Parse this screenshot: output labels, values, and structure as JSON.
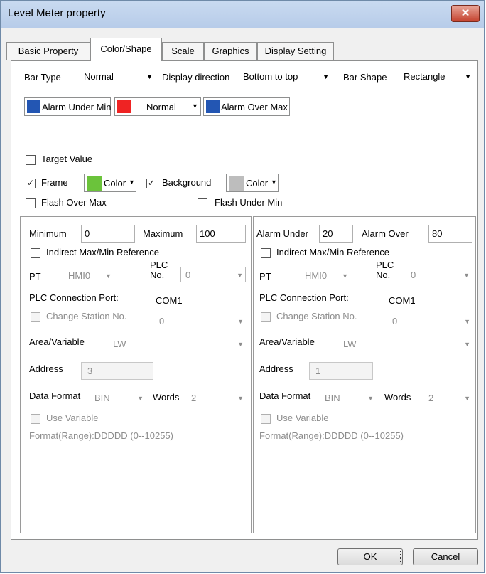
{
  "window": {
    "title": "Level Meter property",
    "close_label": "✕"
  },
  "tabs": [
    "Basic Property",
    "Color/Shape",
    "Scale",
    "Graphics",
    "Display Setting"
  ],
  "bar": {
    "bar_type_label": "Bar Type",
    "bar_type_value": "Normal",
    "direction_label": "Display direction",
    "direction_value": "Bottom to top",
    "shape_label": "Bar Shape",
    "shape_value": "Rectangle"
  },
  "alarm_colors": {
    "under_label": "Alarm Under Min",
    "under_color": "#2356b3",
    "normal_label": "Normal",
    "normal_color": "#ef2323",
    "over_label": "Alarm Over Max",
    "over_color": "#2356b3"
  },
  "options": {
    "target_value": "Target Value",
    "frame": "Frame",
    "frame_color_label": "Color",
    "frame_color": "#6bc33b",
    "background": "Background",
    "background_color_label": "Color",
    "background_color": "#bdbdbd",
    "flash_over_max": "Flash Over Max",
    "flash_under_min": "Flash Under Min"
  },
  "left": {
    "minimum_label": "Minimum",
    "minimum_value": "0",
    "maximum_label": "Maximum",
    "maximum_value": "100",
    "indirect": "Indirect Max/Min Reference",
    "pt_label": "PT",
    "pt_value": "HMI0",
    "plc_label_1": "PLC",
    "plc_label_2": "No.",
    "plc_value": "0",
    "port_label": "PLC Connection Port:",
    "port_value": "COM1",
    "station_label": "Change Station No.",
    "station_value": "0",
    "area_label": "Area/Variable",
    "area_value": "LW",
    "address_label": "Address",
    "address_value": "3",
    "format_label": "Data Format",
    "format_value": "BIN",
    "words_label": "Words",
    "words_value": "2",
    "use_variable": "Use Variable",
    "range": "Format(Range):DDDDD (0--10255)"
  },
  "right": {
    "alarm_under_label": "Alarm Under",
    "alarm_under_value": "20",
    "alarm_over_label": "Alarm Over",
    "alarm_over_value": "80",
    "indirect": "Indirect Max/Min Reference",
    "pt_label": "PT",
    "pt_value": "HMI0",
    "plc_label_1": "PLC",
    "plc_label_2": "No.",
    "plc_value": "0",
    "port_label": "PLC Connection Port:",
    "port_value": "COM1",
    "station_label": "Change Station No.",
    "station_value": "0",
    "area_label": "Area/Variable",
    "area_value": "LW",
    "address_label": "Address",
    "address_value": "1",
    "format_label": "Data Format",
    "format_value": "BIN",
    "words_label": "Words",
    "words_value": "2",
    "use_variable": "Use Variable",
    "range": "Format(Range):DDDDD (0--10255)"
  },
  "buttons": {
    "ok": "OK",
    "cancel": "Cancel"
  },
  "icons": {
    "dropdown": "▼",
    "check": "✓"
  }
}
